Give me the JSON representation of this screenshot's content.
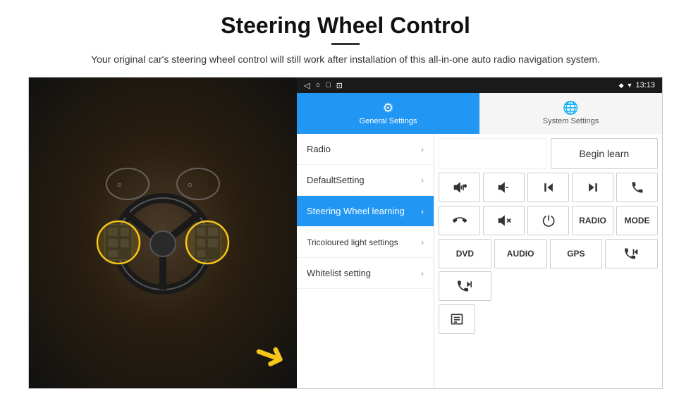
{
  "header": {
    "title": "Steering Wheel Control",
    "subtitle": "Your original car's steering wheel control will still work after installation of this all-in-one auto radio navigation system."
  },
  "status_bar": {
    "icons": [
      "◁",
      "○",
      "□",
      "⊡"
    ],
    "time": "13:13",
    "signal": "♦ ▼"
  },
  "tabs": [
    {
      "label": "General Settings",
      "active": true
    },
    {
      "label": "System Settings",
      "active": false
    }
  ],
  "menu_items": [
    {
      "label": "Radio",
      "active": false
    },
    {
      "label": "DefaultSetting",
      "active": false
    },
    {
      "label": "Steering Wheel learning",
      "active": true
    },
    {
      "label": "Tricoloured light settings",
      "active": false
    },
    {
      "label": "Whitelist setting",
      "active": false
    }
  ],
  "control_panel": {
    "begin_learn": "Begin learn",
    "row1": [
      "🔊+",
      "🔊−",
      "⏮",
      "⏭",
      "📞"
    ],
    "row2": [
      "📞↩",
      "🔊✕",
      "⏻",
      "RADIO",
      "MODE"
    ],
    "row3": [
      "DVD",
      "AUDIO",
      "GPS",
      "📞⏮",
      "📞⏭"
    ]
  },
  "icon_map": {
    "settings_gear": "⚙",
    "system_globe": "🌐",
    "chevron": "›",
    "back": "◁",
    "home": "○",
    "recent": "□",
    "screenshot": "⊡"
  }
}
